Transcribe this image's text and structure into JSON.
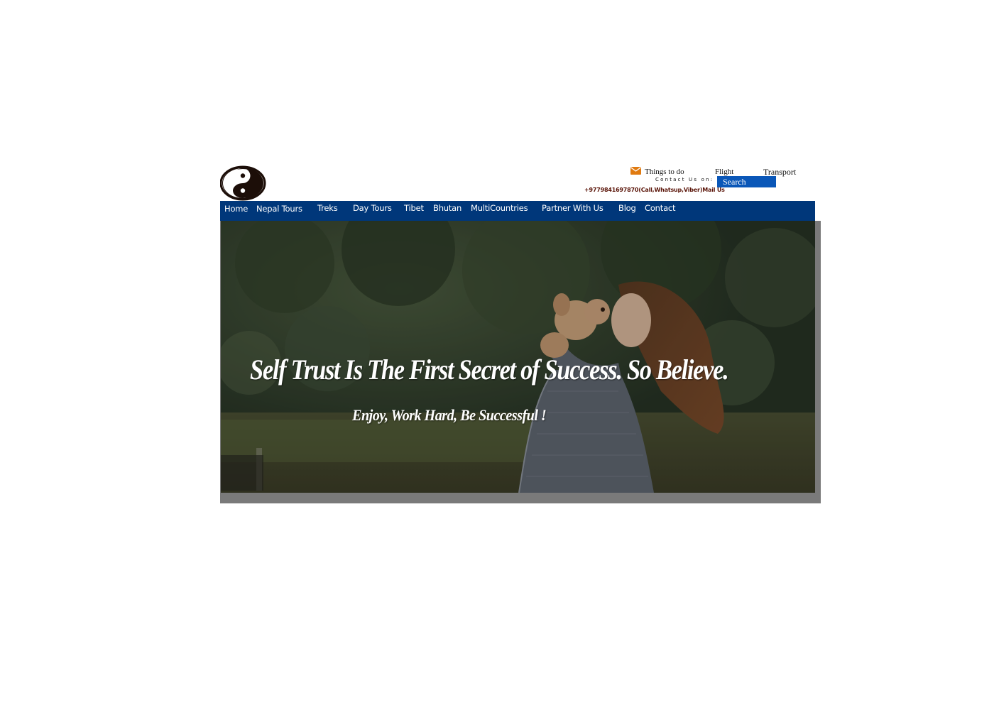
{
  "header": {
    "logo_icon": "yin-yang-icon",
    "top_links": {
      "mail_icon": "envelope-icon",
      "things_to_do": "Things to do",
      "flight": "Flight",
      "transport": "Transport"
    },
    "contact_label": "Contact Us on:",
    "search": {
      "value": "Search"
    },
    "phone": "+9779841697870(Call,Whatsup,Viber)",
    "mail_us": "Mail Us"
  },
  "nav": {
    "items": [
      {
        "label": "Home"
      },
      {
        "label": "Nepal Tours"
      },
      {
        "label": "Treks"
      },
      {
        "label": "Day Tours"
      },
      {
        "label": "Tibet"
      },
      {
        "label": "Bhutan"
      },
      {
        "label": "MultiCountries"
      },
      {
        "label": "Partner With Us"
      },
      {
        "label": "Blog"
      },
      {
        "label": "Contact"
      }
    ],
    "background": "#00377a"
  },
  "hero": {
    "headline": "Self Trust Is The First Secret of Success. So Believe.",
    "subline": "Enjoy, Work Hard, Be Successful !"
  },
  "colors": {
    "search_bg": "#0a57b8",
    "phone_text": "#5a1408",
    "mail_icon": "#e07a10"
  }
}
